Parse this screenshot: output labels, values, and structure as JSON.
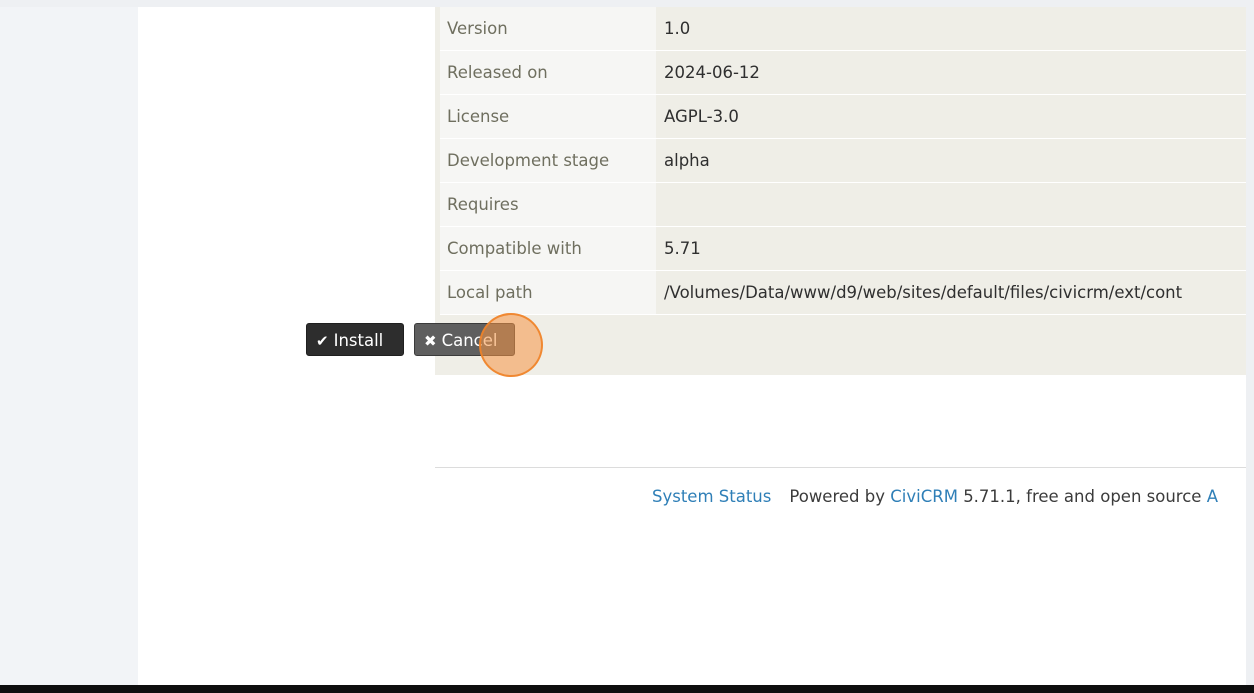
{
  "info": {
    "rows": [
      {
        "label": "Version",
        "value": "1.0"
      },
      {
        "label": "Released on",
        "value": "2024-06-12"
      },
      {
        "label": "License",
        "value": "AGPL-3.0"
      },
      {
        "label": "Development stage",
        "value": "alpha"
      },
      {
        "label": "Requires",
        "value": ""
      },
      {
        "label": "Compatible with",
        "value": "5.71"
      },
      {
        "label": "Local path",
        "value": "/Volumes/Data/www/d9/web/sites/default/files/civicrm/ext/cont"
      }
    ]
  },
  "actions": {
    "install_label": "Install",
    "cancel_label": "Cancel"
  },
  "footer": {
    "status_link": "System Status",
    "powered_by": "Powered by",
    "civicrm_link": "CiviCRM",
    "version_text": "5.71.1, free and open source",
    "trailing_link": "A"
  },
  "colors": {
    "link": "#2f7fb7",
    "install_button": "#2d2d2d",
    "cancel_button": "#5f5f5f",
    "panel_bg": "#efeee7",
    "click_highlight": "#f59646"
  }
}
